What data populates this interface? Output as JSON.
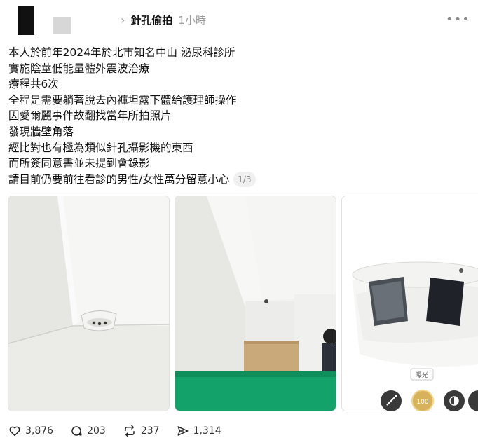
{
  "post": {
    "author": "針孔偷拍",
    "time": "1小時",
    "more_glyph": "•••",
    "lines": [
      "本人於前年2024年於北市知名中山     泌尿科診所",
      "實施陰莖低能量體外震波治療",
      "療程共6次",
      "全程是需要躺著脫去內褲坦露下體給護理師操作",
      "因愛爾麗事件故翻找當年所拍照片",
      "發現牆壁角落",
      "經比對也有極為類似針孔攝影機的東西",
      "而所簽同意書並未提到會錄影",
      "請目前仍要前往看診的男性/女性萬分留意小心"
    ],
    "image_counter": "1/3"
  },
  "photo3": {
    "badge": "曝光",
    "exposure_value": "100"
  },
  "actions": {
    "likes": "3,876",
    "comments": "203",
    "reposts": "237",
    "shares": "1,314"
  },
  "icons": [
    "chevron-right-icon",
    "more-icon",
    "heart-icon",
    "comment-icon",
    "repost-icon",
    "share-icon",
    "magic-wand-icon",
    "contrast-icon"
  ]
}
